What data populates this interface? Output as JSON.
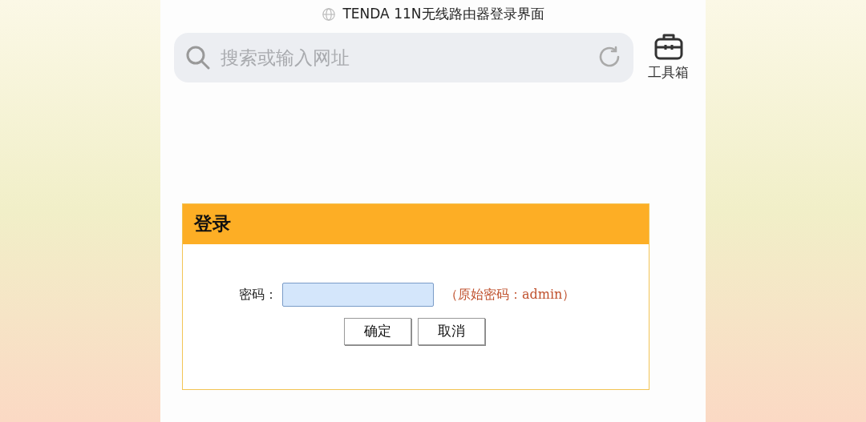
{
  "page": {
    "title": "TENDA 11N无线路由器登录界面"
  },
  "search": {
    "placeholder": "搜索或输入网址"
  },
  "toolbox": {
    "label": "工具箱"
  },
  "login": {
    "title": "登录",
    "password_label": "密码：",
    "hint": "（原始密码：admin）",
    "buttons": [
      "确定",
      "取消"
    ]
  }
}
